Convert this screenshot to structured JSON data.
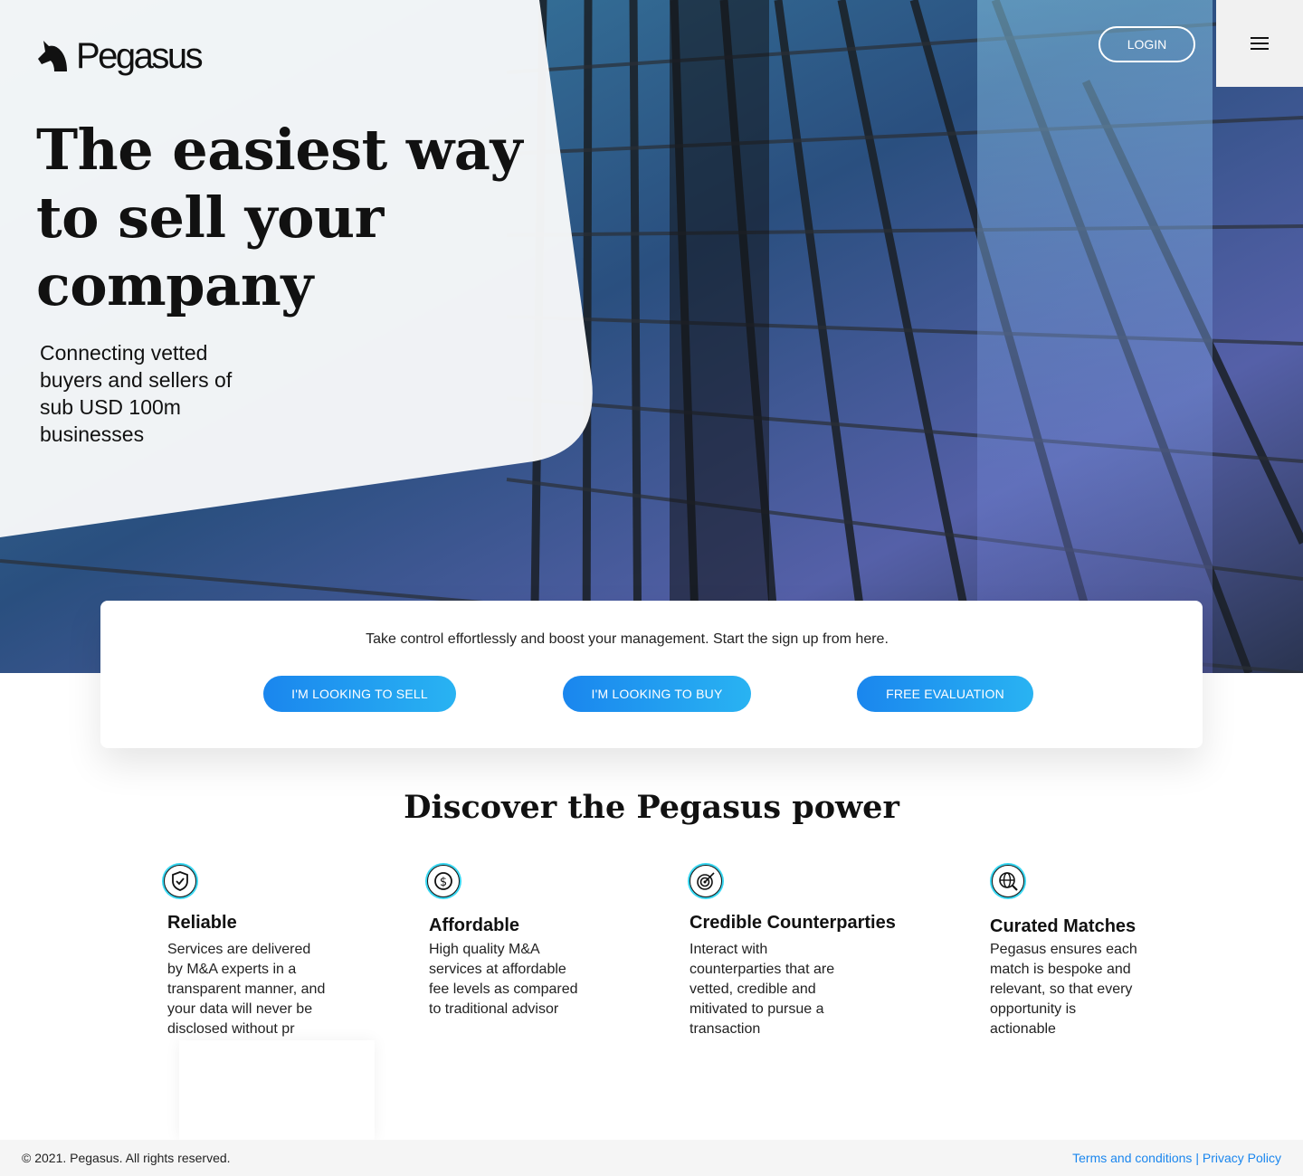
{
  "brand": {
    "name": "Pegasus"
  },
  "hero": {
    "title": "The easiest way to sell your company",
    "subtitle": "Connecting vetted buyers and sellers of sub USD 100m businesses"
  },
  "header": {
    "login_label": "LOGIN",
    "menu_icon": "hamburger-icon"
  },
  "cta": {
    "text": "Take control effortlessly and boost your management. Start the sign up from here.",
    "buttons": [
      {
        "label": "I'M LOOKING TO SELL"
      },
      {
        "label": "I'M LOOKING TO BUY"
      },
      {
        "label": "FREE EVALUATION"
      }
    ]
  },
  "features": {
    "title": "Discover the Pegasus power",
    "items": [
      {
        "icon": "shield-check-icon",
        "title": "Reliable",
        "text": "Services are delivered by M&A experts in a transparent manner, and your data will never be disclosed without pr"
      },
      {
        "icon": "dollar-coin-icon",
        "title": "Affordable",
        "text": "High quality M&A services at affordable fee levels as compared to traditional advisor"
      },
      {
        "icon": "target-icon",
        "title": "Credible Counterparties",
        "text": "Interact with counterparties that are vetted, credible and mitivated to pursue a transaction"
      },
      {
        "icon": "globe-search-icon",
        "title": "Curated Matches",
        "text": "Pegasus ensures each match is bespoke and relevant, so that every opportunity is actionable"
      }
    ]
  },
  "footer": {
    "copyright": "© 2021. Pegasus. All rights reserved.",
    "terms": "Terms and conditions",
    "separator": " | ",
    "privacy": "Privacy Policy"
  },
  "colors": {
    "accent_start": "#1a86ee",
    "accent_end": "#29b3f2",
    "icon_ring": "#37d6f0"
  }
}
